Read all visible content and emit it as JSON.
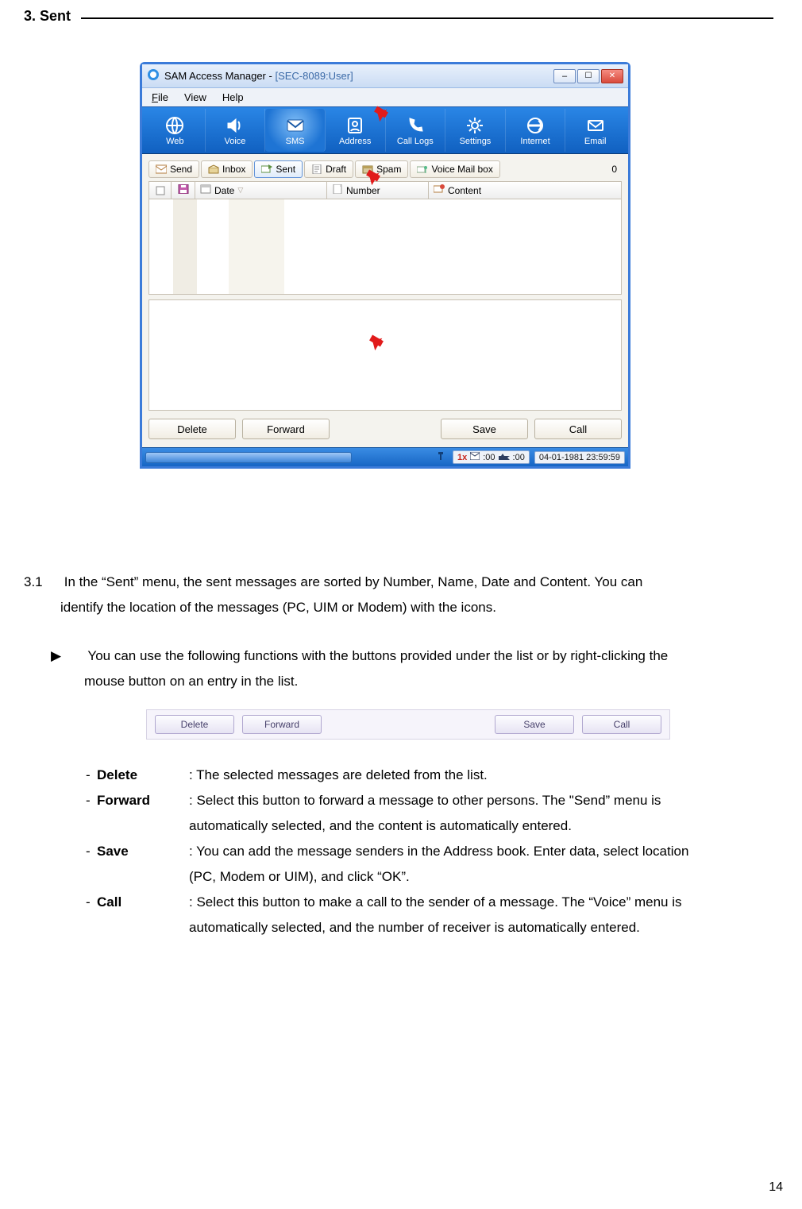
{
  "section": {
    "number": "3.",
    "title": "Sent"
  },
  "page_number": "14",
  "app": {
    "title": "SAM Access Manager - ",
    "subtitle": "[SEC-8089:User]",
    "menu": {
      "file": "File",
      "view": "View",
      "help": "Help"
    },
    "ribbon": {
      "web": "Web",
      "voice": "Voice",
      "sms": "SMS",
      "address": "Address",
      "calllogs": "Call Logs",
      "settings": "Settings",
      "internet": "Internet",
      "email": "Email"
    },
    "tabs": {
      "send": "Send",
      "inbox": "Inbox",
      "sent": "Sent",
      "draft": "Draft",
      "spam": "Spam",
      "voicemail": "Voice Mail box",
      "count_zero": "0"
    },
    "grid": {
      "date": "Date",
      "number": "Number",
      "content": "Content"
    },
    "buttons": {
      "delete": "Delete",
      "forward": "Forward",
      "save": "Save",
      "call": "Call"
    },
    "status": {
      "onex": "1x",
      "c1": ":00",
      "c2": ":00",
      "clock": "04-01-1981 23:59:59"
    }
  },
  "secondary_buttons": {
    "delete": "Delete",
    "forward": "Forward",
    "save": "Save",
    "call": "Call"
  },
  "body": {
    "p31_no": "3.1",
    "p31_a": "In the “Sent” menu, the sent messages are sorted by Number, Name, Date and Content. You can",
    "p31_b": "identify the location of the messages (PC, UIM or Modem) with the icons.",
    "bullet_mark": "▶",
    "bullet_a": "You can use the following functions with the buttons provided under the list or by right-clicking the",
    "bullet_b": "mouse button on an entry in the list.",
    "defs": {
      "delete": {
        "name": "Delete",
        "text": ": The selected messages are deleted from the list."
      },
      "forward": {
        "name": "Forward",
        "text_a": ": Select this button to forward a message to other persons. The \"Send” menu is",
        "text_b": "automatically selected, and the content is automatically entered."
      },
      "save": {
        "name": "Save",
        "text_a": ": You can add the message senders in the Address book. Enter data, select location",
        "text_b": "(PC, Modem or UIM), and click “OK”."
      },
      "call": {
        "name": "Call",
        "text_a": ": Select this button to make a call to the sender of a message. The “Voice” menu is",
        "text_b": "automatically selected, and the number of receiver is automatically entered."
      }
    }
  }
}
